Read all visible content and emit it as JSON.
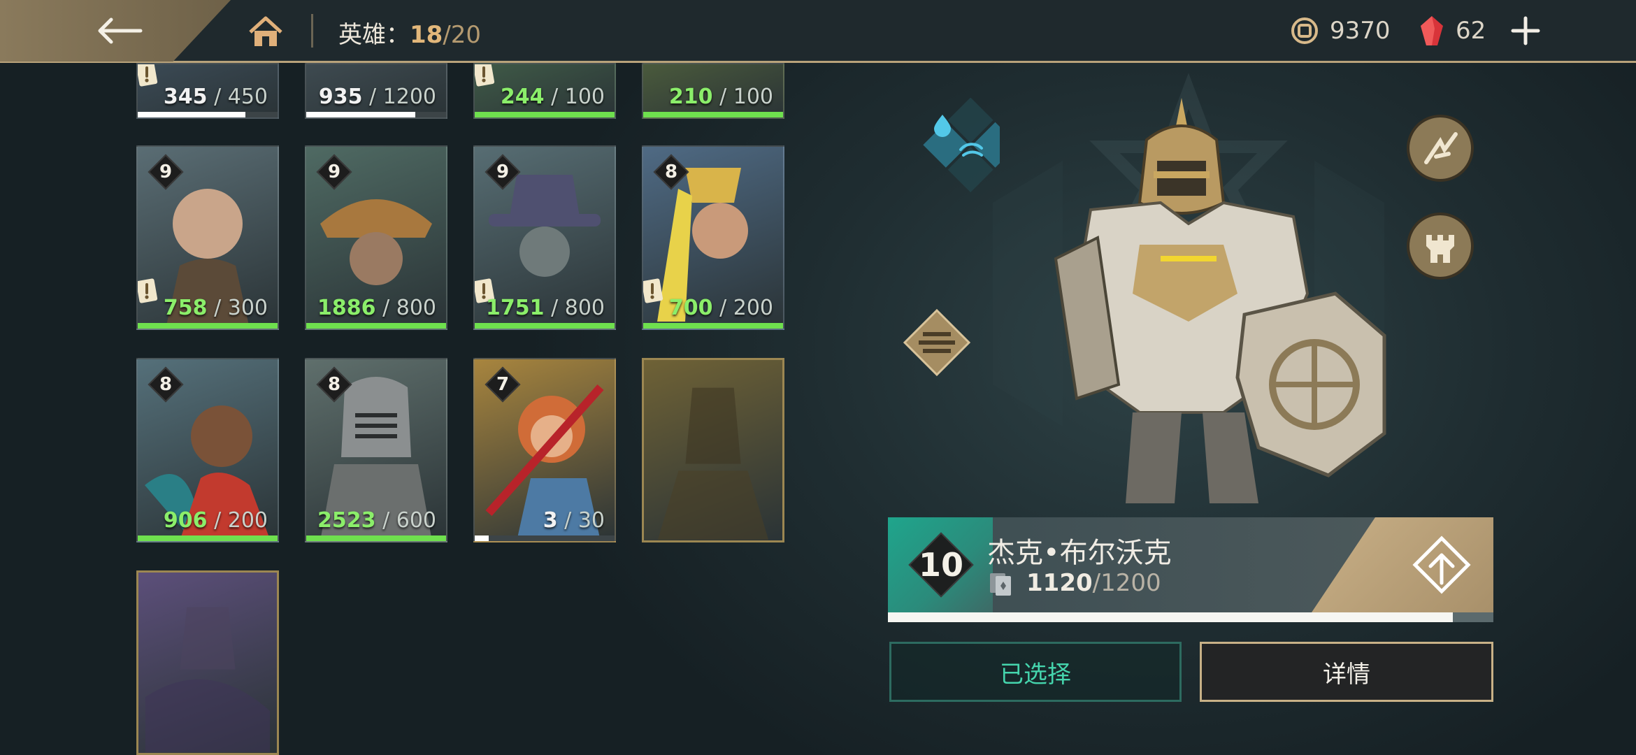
{
  "topbar": {
    "back_icon": "arrow-left-icon",
    "home_icon": "home-icon",
    "hero_label": "英雄：",
    "hero_owned": "18",
    "hero_sep": "/",
    "hero_total": "20",
    "coins": "9370",
    "gems": "62",
    "coin_icon": "coin-icon",
    "gem_icon": "gem-icon",
    "plus_icon": "plus-icon"
  },
  "cards": [
    {
      "id": "r0c0",
      "level": "",
      "cur": "345",
      "req": "450",
      "progress": 0.77,
      "bar": "white",
      "alert": true,
      "theme": "#3b4a55"
    },
    {
      "id": "r0c1",
      "level": "",
      "cur": "935",
      "req": "1200",
      "progress": 0.78,
      "bar": "white",
      "alert": false,
      "theme": "#3e4a50"
    },
    {
      "id": "r0c2",
      "level": "",
      "cur": "244",
      "req": "100",
      "progress": 1.0,
      "bar": "green",
      "alert": true,
      "theme": "#3f5a47"
    },
    {
      "id": "r0c3",
      "level": "",
      "cur": "210",
      "req": "100",
      "progress": 1.0,
      "bar": "green",
      "alert": false,
      "theme": "#4a5a3c"
    },
    {
      "id": "r1c0",
      "level": "9",
      "cur": "758",
      "req": "300",
      "progress": 1.0,
      "bar": "green",
      "alert": true,
      "theme": "#5a6d74"
    },
    {
      "id": "r1c1",
      "level": "9",
      "cur": "1886",
      "req": "800",
      "progress": 1.0,
      "bar": "green",
      "alert": false,
      "theme": "#4f6a63"
    },
    {
      "id": "r1c2",
      "level": "9",
      "cur": "1751",
      "req": "800",
      "progress": 1.0,
      "bar": "green",
      "alert": true,
      "theme": "#576d73"
    },
    {
      "id": "r1c3",
      "level": "8",
      "cur": "700",
      "req": "200",
      "progress": 1.0,
      "bar": "green",
      "alert": true,
      "theme": "#4f6a84"
    },
    {
      "id": "r2c0",
      "level": "8",
      "cur": "906",
      "req": "200",
      "progress": 1.0,
      "bar": "green",
      "alert": false,
      "theme": "#55707a"
    },
    {
      "id": "r2c1",
      "level": "8",
      "cur": "2523",
      "req": "600",
      "progress": 1.0,
      "bar": "green",
      "alert": false,
      "theme": "#5f6f6c"
    },
    {
      "id": "r2c2",
      "level": "7",
      "cur": "3",
      "req": "30",
      "progress": 0.1,
      "bar": "white",
      "alert": false,
      "theme": "#a8853e"
    },
    {
      "id": "r2c3",
      "level": "",
      "cur": "",
      "req": "",
      "progress": 0,
      "bar": "none",
      "alert": false,
      "theme": "#6f6236",
      "locked": true
    },
    {
      "id": "r3c0",
      "level": "",
      "cur": "",
      "req": "",
      "progress": 0,
      "bar": "none",
      "alert": false,
      "theme": "#5c4f7a",
      "locked": true
    }
  ],
  "hero": {
    "level": "10",
    "name": "杰克•布尔沃克",
    "shards_cur": "1120",
    "shards_sep": "/",
    "shards_req": "1200",
    "shard_progress": 0.933,
    "card_icon": "cards-icon",
    "upgrade_icon": "upgrade-arrow-icon"
  },
  "actions": {
    "selected_label": "已选择",
    "details_label": "详情"
  },
  "icons": {
    "element_water": "water-element-icon",
    "element_wind": "wind-element-icon",
    "class_badge": "class-badge-icon",
    "skill_1": "shatter-skill-icon",
    "skill_2": "tower-skill-icon"
  },
  "colors": {
    "accent_gold": "#c8b187",
    "accent_teal": "#45d5ad",
    "bar_green": "#6fe04e"
  }
}
